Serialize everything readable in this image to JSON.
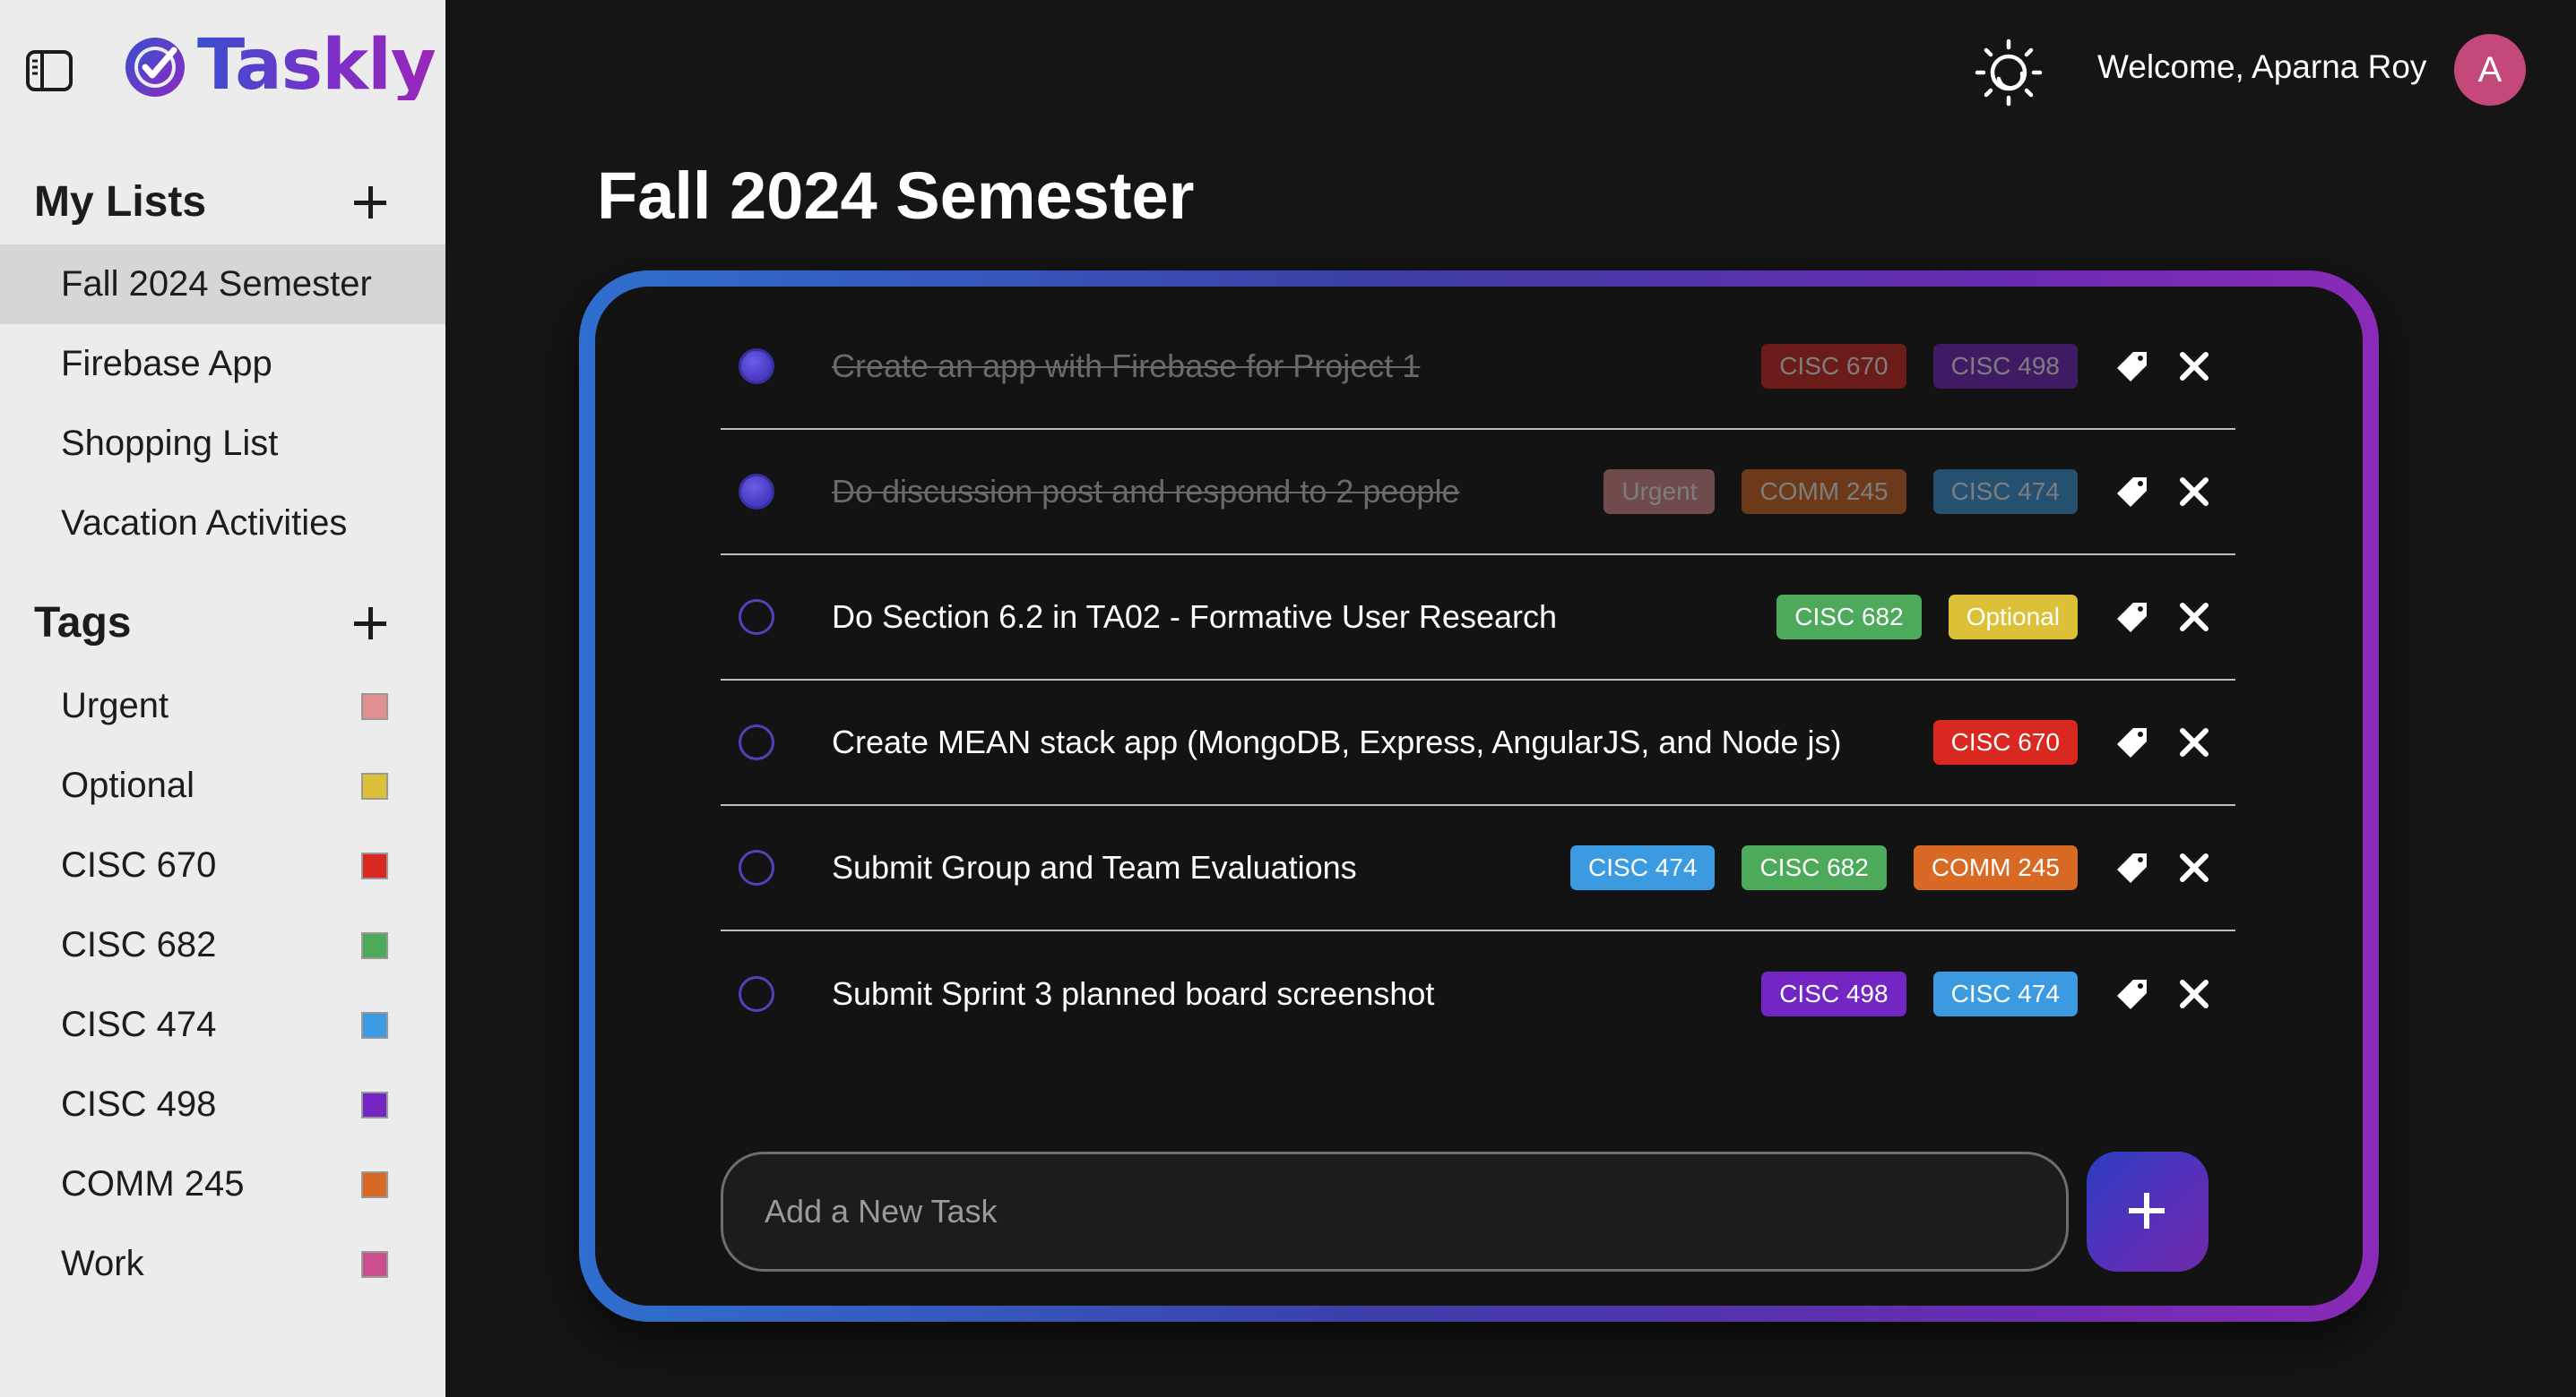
{
  "app": {
    "name": "Taskly"
  },
  "sidebar": {
    "lists_heading": "My Lists",
    "lists": [
      {
        "label": "Fall 2024 Semester",
        "active": true
      },
      {
        "label": "Firebase App",
        "active": false
      },
      {
        "label": "Shopping List",
        "active": false
      },
      {
        "label": "Vacation Activities",
        "active": false
      }
    ],
    "tags_heading": "Tags",
    "tags": [
      {
        "label": "Urgent",
        "color": "#e09090"
      },
      {
        "label": "Optional",
        "color": "#dcc138"
      },
      {
        "label": "CISC 670",
        "color": "#d8281f"
      },
      {
        "label": "CISC 682",
        "color": "#4caa5a"
      },
      {
        "label": "CISC 474",
        "color": "#3c9be0"
      },
      {
        "label": "CISC 498",
        "color": "#7326c4"
      },
      {
        "label": "COMM 245",
        "color": "#d86a26"
      },
      {
        "label": "Work",
        "color": "#cc4e8e"
      }
    ]
  },
  "header": {
    "welcome": "Welcome, Aparna Roy",
    "avatar_initial": "A",
    "theme_icon": "sun-moon-icon"
  },
  "main": {
    "title": "Fall 2024 Semester",
    "tasks": [
      {
        "text": "Create an app with Firebase for Project 1",
        "done": true,
        "tags": [
          "CISC 670",
          "CISC 498"
        ]
      },
      {
        "text": "Do discussion post and respond to 2 people",
        "done": true,
        "tags": [
          "Urgent",
          "COMM 245",
          "CISC 474"
        ]
      },
      {
        "text": "Do Section 6.2 in TA02 - Formative User Research",
        "done": false,
        "tags": [
          "CISC 682",
          "Optional"
        ]
      },
      {
        "text": "Create MEAN stack app (MongoDB, Express, AngularJS, and Node js)",
        "done": false,
        "tags": [
          "CISC 670"
        ]
      },
      {
        "text": "Submit Group and Team Evaluations",
        "done": false,
        "tags": [
          "CISC 474",
          "CISC 682",
          "COMM 245"
        ]
      },
      {
        "text": "Submit Sprint 3 planned board screenshot",
        "done": false,
        "tags": [
          "CISC 498",
          "CISC 474"
        ]
      }
    ],
    "new_task_placeholder": "Add a New Task"
  },
  "colors": {
    "accent_gradient_start": "#2f6fcf",
    "accent_gradient_end": "#8a2bb8",
    "background": "#151515",
    "sidebar": "#ececec"
  }
}
